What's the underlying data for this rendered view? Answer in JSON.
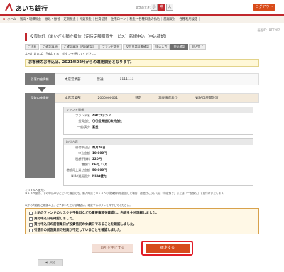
{
  "header": {
    "bank_name": "あいち銀行",
    "font_size_label": "文字の大きさ",
    "font_sizes": [
      "小",
      "中",
      "大"
    ],
    "logout": "ログアウト"
  },
  "nav": {
    "items": [
      "ホーム",
      "残高・明細照会",
      "振込・振替",
      "定期預金",
      "外貨預金",
      "投資信託",
      "住宅ローン",
      "税金・各種料金の払込",
      "諸届受付",
      "各種利用設定"
    ]
  },
  "screen_id": "画面ID：BTT207",
  "page": {
    "title": "投資信託（あいぎん積立投信（定時定額購買サービス）新規申込（申込確認）",
    "steps": [
      "ご注意",
      "ご確認事項",
      "ご確認事項（内容確認）",
      "ファンド選択",
      "交付目論見書確認",
      "申込入力",
      "申込確認",
      "申込完了"
    ],
    "instruction": "よろしければ、「確定する」ボタンを押してください。",
    "notice": "お客様のお申込は、2021年02月からの適用開始となります。"
  },
  "transfer_account": {
    "label": "引落口座情報",
    "branch": "本店営業部",
    "type": "普通",
    "number": "1111111"
  },
  "receive_account": {
    "label": "受取口座情報",
    "branch": "本店営業部",
    "number": "2000000001",
    "kind": "特定",
    "withholding": "源泉徴収あり",
    "nisa": "NISA口座開設済"
  },
  "fund_info": {
    "title": "ファンド情報",
    "rows": [
      {
        "key": "ファンド名",
        "value": "ABCファンド"
      },
      {
        "key": "投資会社",
        "value": "〇〇投資信託株式会社"
      },
      {
        "key": "一般/実分",
        "value": "累投"
      }
    ]
  },
  "trade_info": {
    "title": "取引内容",
    "rows": [
      {
        "key": "積付申込日",
        "value": "毎月26日"
      },
      {
        "key": "申込金額",
        "value": "10,000円"
      },
      {
        "key": "税額手数料",
        "value": "220円"
      },
      {
        "key": "増額月",
        "value": "06月,12月"
      },
      {
        "key": "増額月上乗せ金額",
        "value": "50,000円"
      },
      {
        "key": "NISA適用区分",
        "value": "NISA優先"
      }
    ]
  },
  "nisa_note": {
    "heading": "＜ＮＩＳＡ優先＞",
    "text": "ＮＩＳＡ優先、での申込みいただいた場合でも、購入時点でＮＩＳＡの非課税枠を超過した場合、超過分については「特定預り」または「一般預り」で買付けいたします。"
  },
  "checks": {
    "lead": "以下の内容をご確認の上、ご了承いただける場合は、確定するボタンを押下してください。",
    "items": [
      "上記のファンドのリスクや手数料などの重要事項を確認し、内容を十分理解しました。",
      "買付申込日を確認しました。",
      "買付申込日の前営業日が投資信託の休業日であることを確認しました。",
      "引落日の前営業日の残高が不足していることを確認しました。"
    ]
  },
  "buttons": {
    "stop": "取引を中止する",
    "confirm": "確定する",
    "back": "戻る"
  },
  "colors": {
    "brand": "#c1272d",
    "confirm": "#d74b1d",
    "highlight": "#e11d28"
  }
}
